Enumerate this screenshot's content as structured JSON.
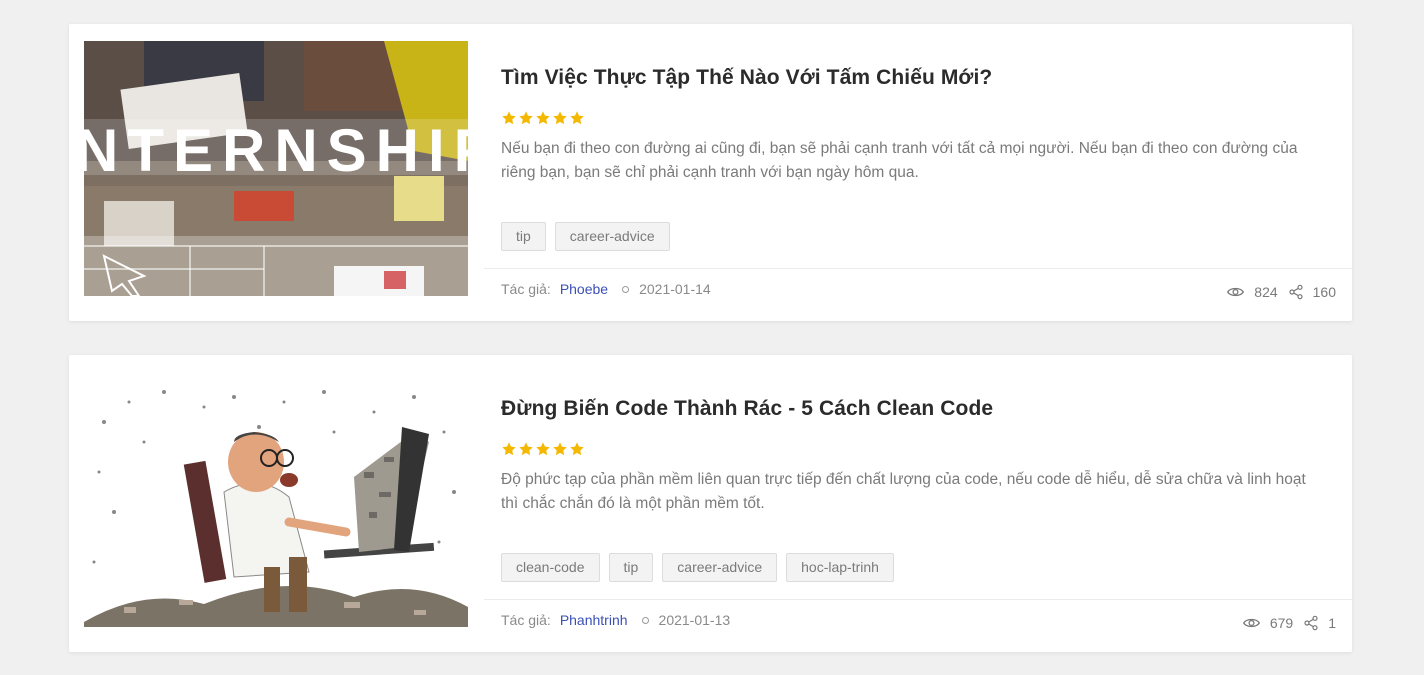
{
  "posts": [
    {
      "title": "Tìm Việc Thực Tập Thế Nào Với Tấm Chiếu Mới?",
      "rating": 5,
      "excerpt": "Nếu bạn đi theo con đường ai cũng đi, bạn sẽ phải cạnh tranh với tất cả mọi người. Nếu bạn đi theo con đường của riêng bạn, bạn sẽ chỉ phải cạnh tranh với bạn ngày hôm qua.",
      "tags": [
        "tip",
        "career-advice"
      ],
      "author_label": "Tác giả:",
      "author": "Phoebe",
      "date": "2021-01-14",
      "views": "824",
      "shares": "160",
      "image_text": "INTERNSHIP"
    },
    {
      "title": "Đừng Biến Code Thành Rác - 5 Cách Clean Code",
      "rating": 5,
      "excerpt": "Độ phức tạp của phần mềm liên quan trực tiếp đến chất lượng của code, nếu code dễ hiểu, dễ sửa chữa và linh hoạt thì chắc chắn đó là một phần mềm tốt.",
      "tags": [
        "clean-code",
        "tip",
        "career-advice",
        "hoc-lap-trinh"
      ],
      "author_label": "Tác giả:",
      "author": "Phanhtrinh",
      "date": "2021-01-13",
      "views": "679",
      "shares": "1"
    }
  ],
  "colors": {
    "star": "#f5b800",
    "author_link": "#3b50b5",
    "background": "#f0f0f0"
  },
  "icons": {
    "rating": "star-icon",
    "views": "eye-icon",
    "shares": "share-icon"
  }
}
